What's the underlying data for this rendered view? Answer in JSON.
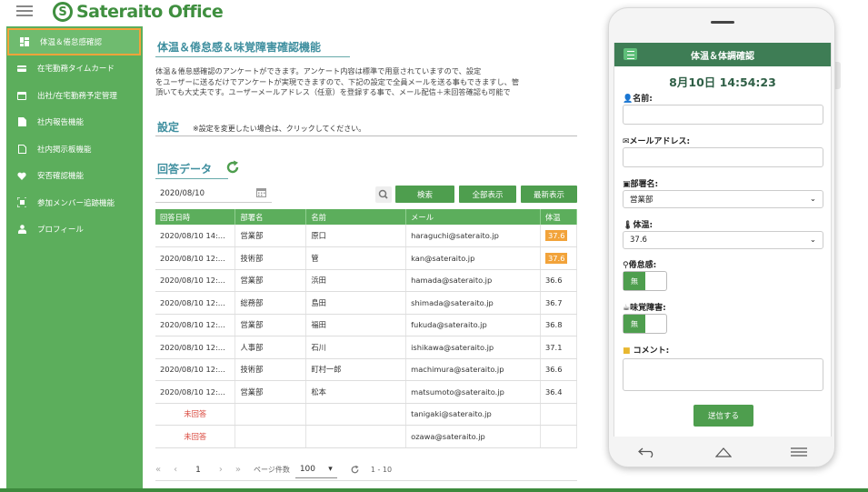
{
  "header": {
    "logo_letter": "S",
    "logo_text": "Sateraito Office"
  },
  "sidebar": {
    "items": [
      {
        "label": "体温＆倦怠感確認",
        "icon": "dashboard-icon"
      },
      {
        "label": "在宅勤務タイムカード",
        "icon": "card-icon"
      },
      {
        "label": "出社/在宅勤務予定管理",
        "icon": "calendar-icon"
      },
      {
        "label": "社内報告機能",
        "icon": "document-icon"
      },
      {
        "label": "社内掲示板機能",
        "icon": "file-icon"
      },
      {
        "label": "安否確認機能",
        "icon": "heart-icon"
      },
      {
        "label": "参加メンバー追跡機能",
        "icon": "qr-scan-icon"
      },
      {
        "label": "プロフィール",
        "icon": "person-icon"
      }
    ]
  },
  "main": {
    "title": "体温＆倦怠感＆味覚障害確認機能",
    "description": [
      "体温＆倦怠感確認のアンケートができます。アンケート内容は標準で用意されていますので、設定",
      "をユーザーに送るだけでアンケートが実現できますので、下記の設定で全員メールを送る事もできますし、管",
      "頂いても大丈夫です。ユーザーメールアドレス（任意）を登録する事で、メール配信＋未回答確認も可能で"
    ],
    "settings_title": "設定",
    "settings_note": "※設定を変更したい場合は、クリックしてください。",
    "answers_title": "回答データ",
    "date_value": "2020/08/10",
    "buttons": {
      "search": "検索",
      "show_all": "全部表示",
      "latest": "最新表示"
    },
    "table": {
      "headers": [
        "回答日時",
        "部署名",
        "名前",
        "メール",
        "体温"
      ],
      "rows": [
        [
          "2020/08/10 14:...",
          "営業部",
          "原口",
          "haraguchi@sateraito.jp",
          "37.6"
        ],
        [
          "2020/08/10 12:...",
          "技術部",
          "管",
          "kan@sateraito.jp",
          "37.6"
        ],
        [
          "2020/08/10 12:...",
          "営業部",
          "浜田",
          "hamada@sateraito.jp",
          "36.6"
        ],
        [
          "2020/08/10 12:...",
          "総務部",
          "島田",
          "shimada@sateraito.jp",
          "36.7"
        ],
        [
          "2020/08/10 12:...",
          "営業部",
          "福田",
          "fukuda@sateraito.jp",
          "36.8"
        ],
        [
          "2020/08/10 12:...",
          "人事部",
          "石川",
          "ishikawa@sateraito.jp",
          "37.1"
        ],
        [
          "2020/08/10 12:...",
          "技術部",
          "町村一郎",
          "machimura@sateraito.jp",
          "36.6"
        ],
        [
          "2020/08/10 12:...",
          "営業部",
          "松本",
          "matsumoto@sateraito.jp",
          "36.4"
        ],
        [
          "未回答",
          "",
          "",
          "tanigaki@sateraito.jp",
          ""
        ],
        [
          "未回答",
          "",
          "",
          "ozawa@sateraito.jp",
          ""
        ]
      ],
      "high_temp_rows": [
        0,
        1
      ],
      "unanswered_rows": [
        8,
        9
      ],
      "colors": {
        "header": "#5cae5c",
        "high_temp": "#f2a33a",
        "unanswered": "#d9463b"
      }
    },
    "pager": {
      "first": "«",
      "prev": "‹",
      "page": "1",
      "next": "›",
      "last": "»",
      "page_size_label": "ページ件数",
      "page_size": "100",
      "range": "1 - 10"
    }
  },
  "phone": {
    "title": "体温＆体調確認",
    "clock": "8月10日 14:54:23",
    "labels": {
      "name": "名前:",
      "email": "メールアドレス:",
      "department": "部署名:",
      "temperature": "体温:",
      "fatigue": "倦怠感:",
      "taste": "味覚障害:",
      "comment": "コメント:"
    },
    "department_value": "営業部",
    "temperature_value": "37.6",
    "fatigue_value": "無",
    "taste_value": "無",
    "submit": "送信する"
  }
}
